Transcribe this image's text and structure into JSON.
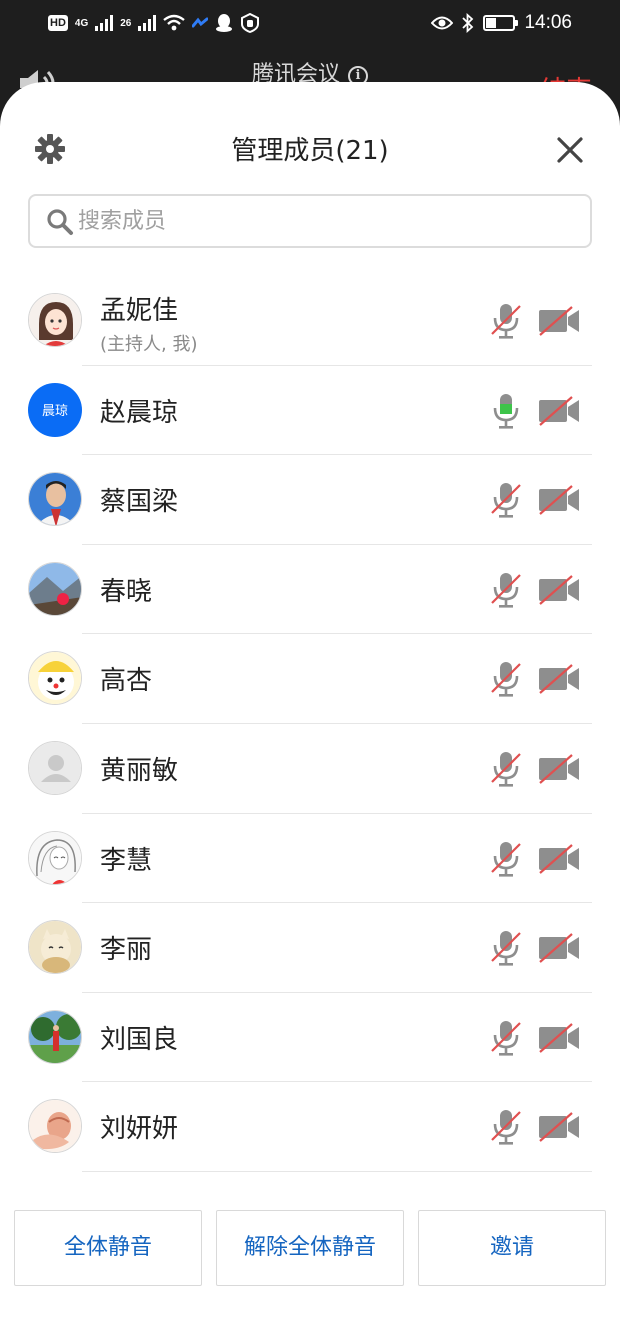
{
  "status_bar": {
    "hd": "HD",
    "sim1": "4G",
    "sim2": "26",
    "time": "14:06",
    "battery_level": 0.35
  },
  "meeting_header": {
    "title": "腾讯会议",
    "end_label": "结束"
  },
  "panel": {
    "title": "管理成员(21)",
    "search_placeholder": "搜索成员"
  },
  "members": [
    {
      "name": "孟妮佳",
      "subtitle": "(主持人, 我)",
      "avatar": "photo-girl-cartoon",
      "mic": "muted",
      "camera": "off"
    },
    {
      "name": "赵晨琼",
      "subtitle": "",
      "avatar_text": "晨琼",
      "avatar": "initials",
      "mic": "active",
      "camera": "off"
    },
    {
      "name": "蔡国梁",
      "subtitle": "",
      "avatar": "photo-man-suit",
      "mic": "muted",
      "camera": "off"
    },
    {
      "name": "春晓",
      "subtitle": "",
      "avatar": "photo-landscape",
      "mic": "muted",
      "camera": "off"
    },
    {
      "name": "高杏",
      "subtitle": "",
      "avatar": "photo-cartoon-face",
      "mic": "muted",
      "camera": "off"
    },
    {
      "name": "黄丽敏",
      "subtitle": "",
      "avatar": "default-person",
      "mic": "muted",
      "camera": "off"
    },
    {
      "name": "李慧",
      "subtitle": "",
      "avatar": "photo-sketch-girl",
      "mic": "muted",
      "camera": "off"
    },
    {
      "name": "李丽",
      "subtitle": "",
      "avatar": "photo-lucky-cat",
      "mic": "muted",
      "camera": "off"
    },
    {
      "name": "刘国良",
      "subtitle": "",
      "avatar": "photo-outdoor-person",
      "mic": "muted",
      "camera": "off"
    },
    {
      "name": "刘妍妍",
      "subtitle": "",
      "avatar": "photo-pink-illustration",
      "mic": "muted",
      "camera": "off"
    }
  ],
  "footer": {
    "mute_all": "全体静音",
    "unmute_all": "解除全体静音",
    "invite": "邀请"
  },
  "colors": {
    "accent_blue": "#1565c0",
    "avatar_blue": "#0a6cf5",
    "muted_slash": "#e05050",
    "active_mic": "#3ec44a",
    "icon_gray": "#8e8e8e"
  }
}
